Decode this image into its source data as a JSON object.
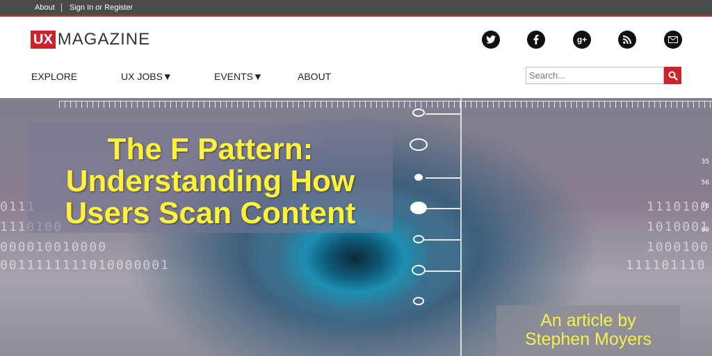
{
  "topbar": {
    "about": "About",
    "signin": "Sign In or Register"
  },
  "logo": {
    "ux": "UX",
    "magazine": "MAGAZINE"
  },
  "social": [
    {
      "icon": "twitter-icon",
      "glyph": "t"
    },
    {
      "icon": "facebook-icon",
      "glyph": "f"
    },
    {
      "icon": "google-plus-icon",
      "glyph": "g+"
    },
    {
      "icon": "rss-icon",
      "glyph": ")"
    },
    {
      "icon": "email-icon",
      "glyph": "✉"
    }
  ],
  "nav": {
    "explore": "EXPLORE",
    "ux_jobs": "UX JOBS▼",
    "events": "EVENTS▼",
    "about": "ABOUT"
  },
  "search": {
    "placeholder": "Search..."
  },
  "hero": {
    "title_line1": "The F Pattern:",
    "title_line2": "Understanding How",
    "title_line3": "Users Scan Content",
    "byline_line1": "An article by",
    "byline_line2": "Stephen Moyers",
    "binary_rows": [
      "0111",
      "1110100",
      "000010010000",
      "0011111111010000001"
    ],
    "binary_right": [
      "1110100",
      "1010001",
      "1000100",
      "111101110"
    ],
    "scale": [
      "35",
      "56",
      "78",
      "89"
    ]
  },
  "colors": {
    "accent": "#c9252c",
    "title": "#fff23a",
    "topbar": "#4a4a4a"
  }
}
